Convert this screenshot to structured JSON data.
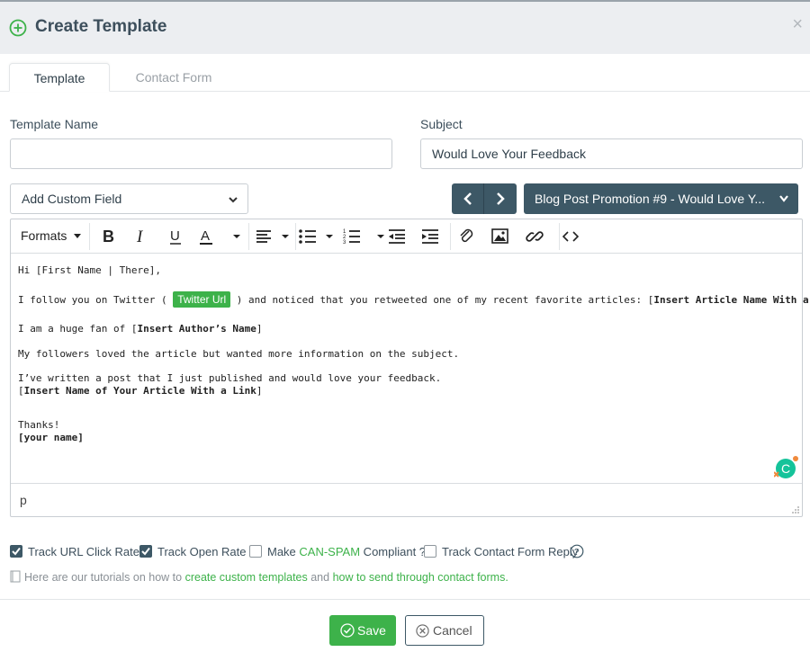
{
  "dialog": {
    "title": "Create Template",
    "close": "×"
  },
  "tabs": [
    {
      "label": "Template",
      "active": true
    },
    {
      "label": "Contact Form",
      "active": false
    }
  ],
  "form": {
    "template_name_label": "Template Name",
    "template_name_value": "",
    "subject_label": "Subject",
    "subject_value": "Would Love Your Feedback",
    "custom_field_label": "Add Custom Field",
    "template_select_label": "Blog Post Promotion #9 - Would Love Y..."
  },
  "toolbar": {
    "formats_label": "Formats",
    "icons": [
      "bold-icon",
      "italic-icon",
      "underline-icon",
      "text-color-icon",
      "align-left-icon",
      "bullet-list-icon",
      "numbered-list-icon",
      "outdent-icon",
      "indent-icon",
      "attachment-icon",
      "image-icon",
      "link-icon",
      "source-code-icon"
    ]
  },
  "email_body": {
    "line1": "Hi [First Name | There],",
    "line2_pre": "I follow you on Twitter ( ",
    "line2_tag": "Twitter Url",
    "line2_mid": " ) and noticed that you retweeted one of my recent favorite articles: [",
    "line2_bold": "Insert Article Name With a Link",
    "line2_post": "].",
    "line3_pre": "I am a huge fan of [",
    "line3_bold": "Insert Author’s Name",
    "line3_post": "]",
    "line4": "My followers loved the article but wanted more information on the subject.",
    "line5": "I’ve written a post that I just published and would love your feedback.",
    "line6_pre": "[",
    "line6_bold": "Insert Name of Your Article With a Link",
    "line6_post": "]",
    "line7": "Thanks!",
    "line8": "[your name]"
  },
  "editor_status": "p",
  "options": {
    "track_url": {
      "label": "Track URL Click Rate",
      "checked": true
    },
    "track_open": {
      "label": "Track Open Rate",
      "checked": true
    },
    "can_spam_pre": "Make ",
    "can_spam_link": "CAN-SPAM",
    "can_spam_post": " Compliant ?",
    "can_spam_checked": false,
    "track_reply": {
      "label": "Track Contact Form Reply",
      "checked": false
    },
    "help": "?"
  },
  "tutorial": {
    "pre": "Here are our tutorials on how to ",
    "link1": "create custom templates",
    "mid": " and ",
    "link2": "how to send through contact forms",
    "post": "."
  },
  "buttons": {
    "save": "Save",
    "cancel": "Cancel"
  },
  "colors": {
    "accent_green": "#3db24a",
    "dark_slate": "#3d5866",
    "header_bg": "#eceef1"
  }
}
